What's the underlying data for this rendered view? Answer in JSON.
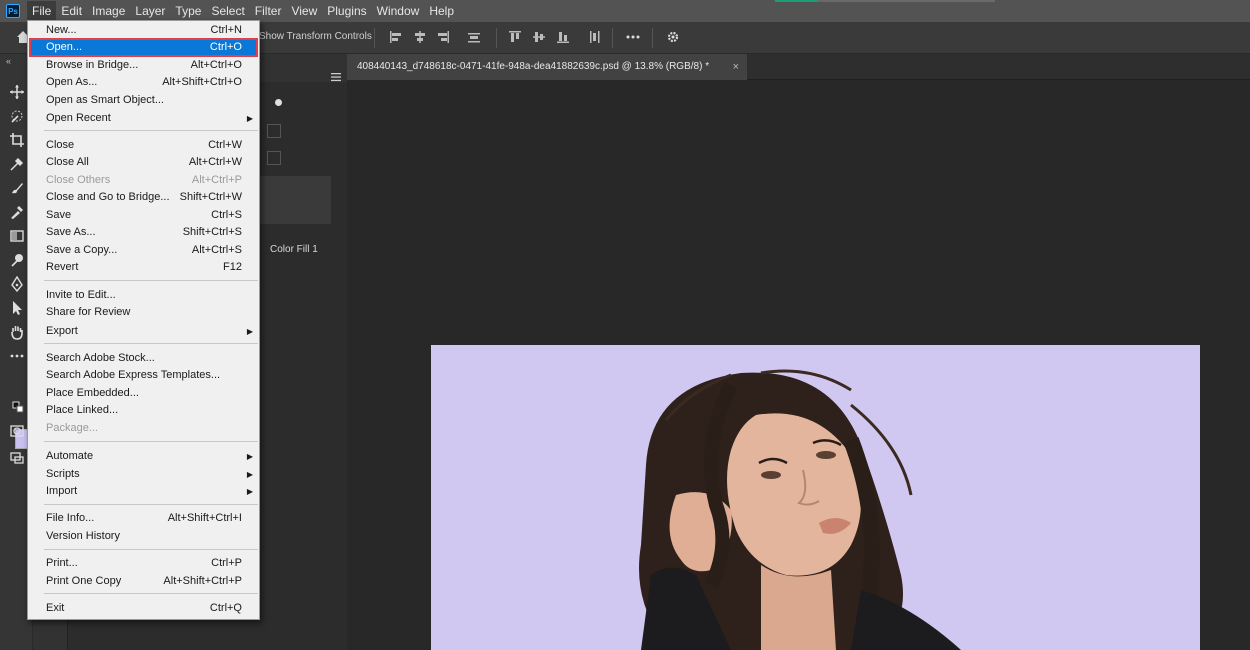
{
  "menubar": {
    "app_logo": "Ps",
    "items": [
      "File",
      "Edit",
      "Image",
      "Layer",
      "Type",
      "Select",
      "Filter",
      "View",
      "Plugins",
      "Window",
      "Help"
    ]
  },
  "options_bar": {
    "show_transform_label": "Show Transform Controls"
  },
  "document": {
    "tab_title": "408440143_d748618c-0471-41fe-948a-dea41882639c.psd @ 13.8% (RGB/8) *",
    "tab_close": "×",
    "canvas_color": "#d0c8f0"
  },
  "layers_panel": {
    "layer_name": "Color Fill 1"
  },
  "file_menu": {
    "groups": [
      [
        {
          "label": "New...",
          "shortcut": "Ctrl+N"
        },
        {
          "label": "Open...",
          "shortcut": "Ctrl+O",
          "highlighted": true
        },
        {
          "label": "Browse in Bridge...",
          "shortcut": "Alt+Ctrl+O"
        },
        {
          "label": "Open As...",
          "shortcut": "Alt+Shift+Ctrl+O"
        },
        {
          "label": "Open as Smart Object...",
          "shortcut": ""
        },
        {
          "label": "Open Recent",
          "shortcut": "",
          "submenu": true
        }
      ],
      [
        {
          "label": "Close",
          "shortcut": "Ctrl+W"
        },
        {
          "label": "Close All",
          "shortcut": "Alt+Ctrl+W"
        },
        {
          "label": "Close Others",
          "shortcut": "Alt+Ctrl+P",
          "disabled": true
        },
        {
          "label": "Close and Go to Bridge...",
          "shortcut": "Shift+Ctrl+W"
        },
        {
          "label": "Save",
          "shortcut": "Ctrl+S"
        },
        {
          "label": "Save As...",
          "shortcut": "Shift+Ctrl+S"
        },
        {
          "label": "Save a Copy...",
          "shortcut": "Alt+Ctrl+S"
        },
        {
          "label": "Revert",
          "shortcut": "F12"
        }
      ],
      [
        {
          "label": "Invite to Edit...",
          "shortcut": ""
        },
        {
          "label": "Share for Review",
          "shortcut": ""
        },
        {
          "label": "Export",
          "shortcut": "",
          "submenu": true
        }
      ],
      [
        {
          "label": "Search Adobe Stock...",
          "shortcut": ""
        },
        {
          "label": "Search Adobe Express Templates...",
          "shortcut": ""
        },
        {
          "label": "Place Embedded...",
          "shortcut": ""
        },
        {
          "label": "Place Linked...",
          "shortcut": ""
        },
        {
          "label": "Package...",
          "shortcut": "",
          "disabled": true
        }
      ],
      [
        {
          "label": "Automate",
          "shortcut": "",
          "submenu": true
        },
        {
          "label": "Scripts",
          "shortcut": "",
          "submenu": true
        },
        {
          "label": "Import",
          "shortcut": "",
          "submenu": true
        }
      ],
      [
        {
          "label": "File Info...",
          "shortcut": "Alt+Shift+Ctrl+I"
        },
        {
          "label": "Version History",
          "shortcut": ""
        }
      ],
      [
        {
          "label": "Print...",
          "shortcut": "Ctrl+P"
        },
        {
          "label": "Print One Copy",
          "shortcut": "Alt+Shift+Ctrl+P"
        }
      ],
      [
        {
          "label": "Exit",
          "shortcut": "Ctrl+Q"
        }
      ]
    ]
  },
  "colors": {
    "highlight": "#0a78d7",
    "highlight_border": "#e0404a",
    "menu_bg": "#f0f0f0",
    "workspace_bg": "#282828"
  }
}
